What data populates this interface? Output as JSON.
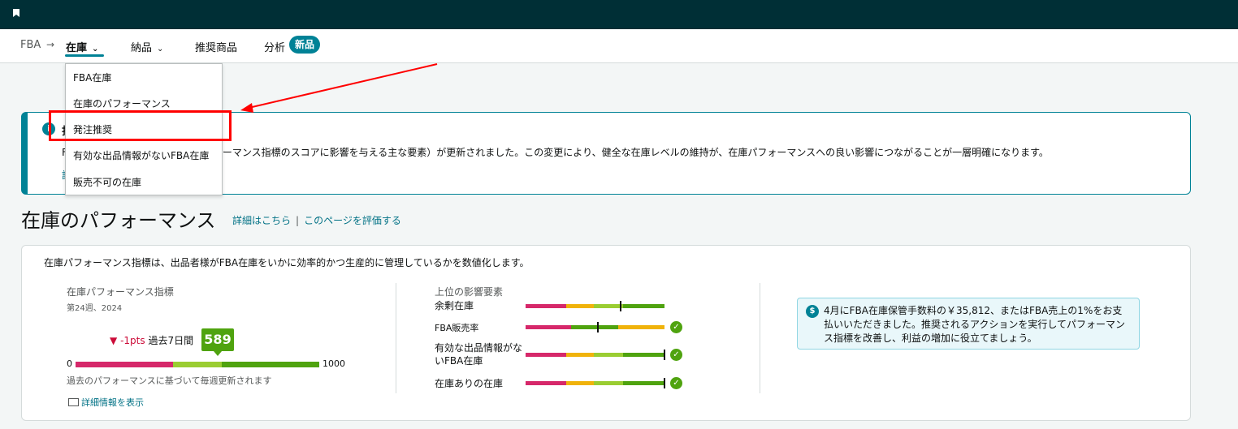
{
  "nav": {
    "crumb": "FBA",
    "crumb_arrow": "→",
    "inventory": "在庫",
    "shipments": "納品",
    "recommended": "推奨商品",
    "analytics": "分析",
    "new_badge": "新品"
  },
  "dropdown": {
    "items": [
      "FBA在庫",
      "在庫のパフォーマンス",
      "発注推奨",
      "有効な出品情報がないFBA在庫",
      "販売不可の在庫"
    ]
  },
  "banner": {
    "title_visible": "打",
    "text_visible": "F",
    "text_tail": "ォーマンス指標のスコアに影響を与える主な要素）が更新されました。この変更により、健全な在庫レベルの維持が、在庫パフォーマンスへの良い影響につながることが一層明確になります。",
    "link_visible": "詳"
  },
  "page": {
    "title": "在庫のパフォーマンス",
    "details_link": "詳細はこちら",
    "separator": "|",
    "rate_link": "このページを評価する"
  },
  "card": {
    "description": "在庫パフォーマンス指標は、出品者様がFBA在庫をいかに効率的かつ生産的に管理しているかを数値化します。"
  },
  "ipi": {
    "label": "在庫パフォーマンス指標",
    "week": "第24週、2024",
    "change_value": "-1pts",
    "change_period": "過去7日間",
    "score": "589",
    "score_value": 589,
    "min": "0",
    "max": "1000",
    "note": "過去のパフォーマンスに基づいて毎週更新されます",
    "detail_link": "詳細情報を表示"
  },
  "factors": {
    "title": "上位の影響要素",
    "items": [
      {
        "label": "余剰在庫",
        "check": false
      },
      {
        "label": "FBA販売率",
        "check": true
      },
      {
        "label": "有効な出品情報がないFBA在庫",
        "check": true
      },
      {
        "label": "在庫ありの在庫",
        "check": true
      }
    ]
  },
  "tip": {
    "message": "4月にFBA在庫保管手数料の￥35,812、またはFBA売上の1%をお支払いいただきました。推奨されるアクションを実行してパフォーマンス指標を改善し、利益の増加に役立てましょう。"
  },
  "colors": {
    "accent": "#008296",
    "topbar": "#002f36",
    "red": "#d6286a",
    "orange": "#f0b30a",
    "lightgreen": "#9acd32",
    "green": "#4fa30f",
    "annotation": "#ff0000"
  }
}
